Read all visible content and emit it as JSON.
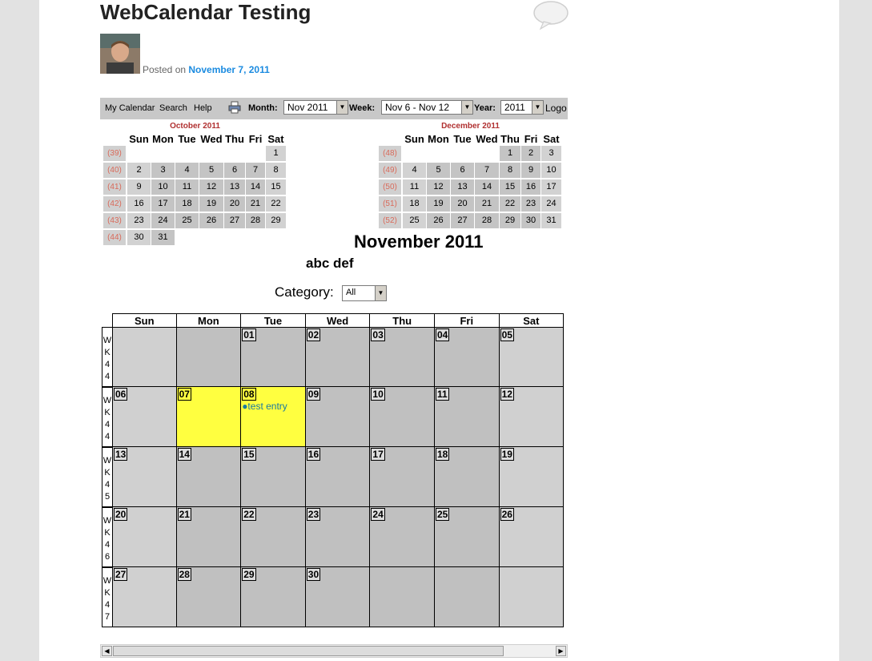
{
  "post": {
    "title": "WebCalendar Testing",
    "posted_prefix": "Posted on",
    "posted_date": "November 7, 2011"
  },
  "toolbar": {
    "links": [
      "My Calendar",
      "Search",
      "Help"
    ],
    "month_label": "Month:",
    "month_value": "Nov 2011",
    "week_label": "Week:",
    "week_value": "Nov 6 - Nov 12",
    "year_label": "Year:",
    "year_value": "2011",
    "logout_text": "Logo"
  },
  "mini_prev": {
    "title": "October 2011",
    "day_headers": [
      "Sun",
      "Mon",
      "Tue",
      "Wed",
      "Thu",
      "Fri",
      "Sat"
    ],
    "weeks": [
      {
        "wk": "(39)",
        "days": [
          "",
          "",
          "",
          "",
          "",
          "",
          "1"
        ]
      },
      {
        "wk": "(40)",
        "days": [
          "2",
          "3",
          "4",
          "5",
          "6",
          "7",
          "8"
        ]
      },
      {
        "wk": "(41)",
        "days": [
          "9",
          "10",
          "11",
          "12",
          "13",
          "14",
          "15"
        ]
      },
      {
        "wk": "(42)",
        "days": [
          "16",
          "17",
          "18",
          "19",
          "20",
          "21",
          "22"
        ]
      },
      {
        "wk": "(43)",
        "days": [
          "23",
          "24",
          "25",
          "26",
          "27",
          "28",
          "29"
        ]
      },
      {
        "wk": "(44)",
        "days": [
          "30",
          "31",
          "",
          "",
          "",
          "",
          ""
        ]
      }
    ]
  },
  "mini_next": {
    "title": "December 2011",
    "day_headers": [
      "Sun",
      "Mon",
      "Tue",
      "Wed",
      "Thu",
      "Fri",
      "Sat"
    ],
    "weeks": [
      {
        "wk": "(48)",
        "days": [
          "",
          "",
          "",
          "",
          "1",
          "2",
          "3"
        ]
      },
      {
        "wk": "(49)",
        "days": [
          "4",
          "5",
          "6",
          "7",
          "8",
          "9",
          "10"
        ]
      },
      {
        "wk": "(50)",
        "days": [
          "11",
          "12",
          "13",
          "14",
          "15",
          "16",
          "17"
        ]
      },
      {
        "wk": "(51)",
        "days": [
          "18",
          "19",
          "20",
          "21",
          "22",
          "23",
          "24"
        ]
      },
      {
        "wk": "(52)",
        "days": [
          "25",
          "26",
          "27",
          "28",
          "29",
          "30",
          "31"
        ]
      }
    ]
  },
  "month_title": "November 2011",
  "sub_title": "abc def",
  "category": {
    "label": "Category:",
    "value": "All"
  },
  "grid": {
    "day_headers": [
      "Sun",
      "Mon",
      "Tue",
      "Wed",
      "Thu",
      "Fri",
      "Sat"
    ],
    "weeks": [
      {
        "label": "WK44",
        "days": [
          "",
          "",
          "01",
          "02",
          "03",
          "04",
          "05"
        ]
      },
      {
        "label": "WK44",
        "days": [
          "06",
          "07",
          "08",
          "09",
          "10",
          "11",
          "12"
        ]
      },
      {
        "label": "WK45",
        "days": [
          "13",
          "14",
          "15",
          "16",
          "17",
          "18",
          "19"
        ]
      },
      {
        "label": "WK46",
        "days": [
          "20",
          "21",
          "22",
          "23",
          "24",
          "25",
          "26"
        ]
      },
      {
        "label": "WK47",
        "days": [
          "27",
          "28",
          "29",
          "30",
          "",
          "",
          ""
        ]
      }
    ],
    "today_day": "07",
    "event_day": "08",
    "event_text": "●test entry"
  },
  "colors": {
    "cell_weekend": "#d0d0d0",
    "cell_weekday": "#c0c0c0",
    "cell_highlight": "#ffff40",
    "mini_title": "#b03030",
    "link": "#1b8be0"
  },
  "icons": {
    "comment": "speech-bubble-icon",
    "print": "printer-icon",
    "scroll_left": "arrow-left-icon",
    "scroll_right": "arrow-right-icon"
  }
}
